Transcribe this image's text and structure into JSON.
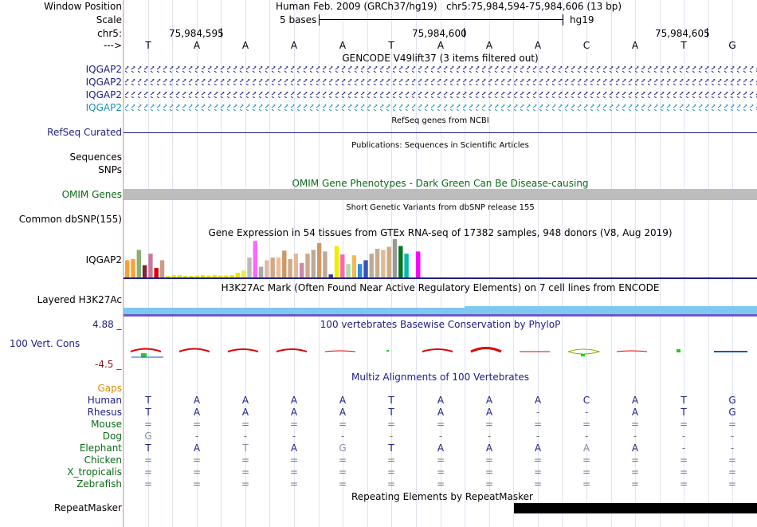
{
  "header": {
    "window_position_label": "Window Position",
    "scale_label": "Scale",
    "chrom_label": "chr5:",
    "strand_label": "--->",
    "title": "Human Feb. 2009 (GRCh37/hg19)   chr5:75,984,594-75,984,606 (13 bp)",
    "scale_text": "5 bases",
    "assembly": "hg19",
    "ticks": [
      "75,984,595",
      "75,984,600",
      "75,984,605"
    ]
  },
  "sequence": [
    "T",
    "A",
    "A",
    "A",
    "A",
    "T",
    "A",
    "A",
    "A",
    "C",
    "A",
    "T",
    "G"
  ],
  "tracks": {
    "gencode": {
      "title": "GENCODE V49lift37 (3 items filtered out)",
      "rows": [
        "IQGAP2",
        "IQGAP2",
        "IQGAP2",
        "IQGAP2"
      ]
    },
    "refseq": {
      "label": "RefSeq Curated",
      "title": "RefSeq genes from NCBI"
    },
    "publications": {
      "title": "Publications: Sequences in Scientific Articles",
      "label1": "Sequences",
      "label2": "SNPs"
    },
    "omim": {
      "label": "OMIM Genes",
      "title": "OMIM Gene Phenotypes - Dark Green Can Be Disease-causing"
    },
    "dbsnp": {
      "label": "Common dbSNP(155)",
      "title": "Short Genetic Variants from dbSNP release 155"
    },
    "gtex": {
      "label": "IQGAP2",
      "title": "Gene Expression in 54 tissues from GTEx RNA-seq of 17382 samples, 948 donors (V8, Aug 2019)"
    },
    "h3k27ac": {
      "label": "Layered H3K27Ac",
      "title": "H3K27Ac Mark (Often Found Near Active Regulatory Elements) on 7 cell lines from ENCODE"
    },
    "phylop": {
      "label": "100 Vert. Cons",
      "max": "4.88 _",
      "min": "-4.5 _",
      "title": "100 vertebrates Basewise Conservation by PhyloP"
    },
    "multiz": {
      "title": "Multiz Alignments of 100 Vertebrates",
      "gaps_label": "Gaps"
    },
    "repeatmasker": {
      "label": "RepeatMasker",
      "title": "Repeating Elements by RepeatMasker"
    }
  },
  "alignment": [
    {
      "species": "Human",
      "bases": [
        "T",
        "A",
        "A",
        "A",
        "A",
        "T",
        "A",
        "A",
        "A",
        "C",
        "A",
        "T",
        "G"
      ]
    },
    {
      "species": "Rhesus",
      "bases": [
        "T",
        "A",
        "A",
        "A",
        "A",
        "T",
        "A",
        "A",
        "-",
        "-",
        "A",
        "T",
        "G"
      ]
    },
    {
      "species": "Mouse",
      "bases": [
        "=",
        "=",
        "=",
        "=",
        "=",
        "=",
        "=",
        "=",
        "=",
        "=",
        "=",
        "=",
        "="
      ]
    },
    {
      "species": "Dog",
      "bases": [
        "G",
        "-",
        "-",
        "-",
        "-",
        "-",
        "-",
        "-",
        "-",
        "-",
        "-",
        "-",
        "-"
      ]
    },
    {
      "species": "Elephant",
      "bases": [
        "T",
        "A",
        "T",
        "A",
        "G",
        "T",
        "A",
        "A",
        "A",
        "A",
        "A",
        "-",
        "-"
      ]
    },
    {
      "species": "Chicken",
      "bases": [
        "=",
        "=",
        "=",
        "=",
        "=",
        "=",
        "=",
        "=",
        "=",
        "=",
        "=",
        "=",
        "="
      ]
    },
    {
      "species": "X_tropicalis",
      "bases": [
        "=",
        "=",
        "=",
        "=",
        "=",
        "=",
        "=",
        "=",
        "=",
        "=",
        "=",
        "=",
        "="
      ]
    },
    {
      "species": "Zebrafish",
      "bases": [
        "=",
        "=",
        "=",
        "=",
        "=",
        "=",
        "=",
        "=",
        "=",
        "=",
        "=",
        "=",
        "="
      ]
    }
  ],
  "gtex_bars": [
    {
      "value": 0.45,
      "color": "#ff9f33"
    },
    {
      "value": 0.48,
      "color": "#ff9f33"
    },
    {
      "value": 0.72,
      "color": "#88b073"
    },
    {
      "value": 0.32,
      "color": "#8a1f38"
    },
    {
      "value": 0.62,
      "color": "#cc7799"
    },
    {
      "value": 0.25,
      "color": "#dd0000"
    },
    {
      "value": 0.45,
      "color": "#cc9988"
    },
    {
      "value": 0.04,
      "color": "#e6e600"
    },
    {
      "value": 0.06,
      "color": "#e6e600"
    },
    {
      "value": 0.06,
      "color": "#e6e600"
    },
    {
      "value": 0.04,
      "color": "#e6e600"
    },
    {
      "value": 0.04,
      "color": "#e6e600"
    },
    {
      "value": 0.05,
      "color": "#e6e600"
    },
    {
      "value": 0.06,
      "color": "#e6e600"
    },
    {
      "value": 0.05,
      "color": "#e6e600"
    },
    {
      "value": 0.06,
      "color": "#e6e600"
    },
    {
      "value": 0.05,
      "color": "#e6e600"
    },
    {
      "value": 0.05,
      "color": "#e6e600"
    },
    {
      "value": 0.06,
      "color": "#e6e600"
    },
    {
      "value": 0.12,
      "color": "#e6e600"
    },
    {
      "value": 0.18,
      "color": "#eeee44"
    },
    {
      "value": 0.52,
      "color": "#bbbbbb"
    },
    {
      "value": 0.95,
      "color": "#ff66ff"
    },
    {
      "value": 0.28,
      "color": "#aaaaaa"
    },
    {
      "value": 0.45,
      "color": "#ddbbaa"
    },
    {
      "value": 0.52,
      "color": "#ccaa88"
    },
    {
      "value": 0.52,
      "color": "#eebb99"
    },
    {
      "value": 0.7,
      "color": "#cc9966"
    },
    {
      "value": 0.48,
      "color": "#ccaa88"
    },
    {
      "value": 0.62,
      "color": "#ddbb99"
    },
    {
      "value": 0.38,
      "color": "#cc88aa"
    },
    {
      "value": 0.62,
      "color": "#ccaa88"
    },
    {
      "value": 0.72,
      "color": "#bbaa99"
    },
    {
      "value": 0.9,
      "color": "#cc9966"
    },
    {
      "value": 0.68,
      "color": "#bbaa99"
    },
    {
      "value": 0.08,
      "color": "#333399"
    },
    {
      "value": 0.82,
      "color": "#eeee00"
    },
    {
      "value": 0.6,
      "color": "#ff66aa"
    },
    {
      "value": 0.35,
      "color": "#aaddaa"
    },
    {
      "value": 0.58,
      "color": "#eebb55"
    },
    {
      "value": 0.35,
      "color": "#3388dd"
    },
    {
      "value": 0.45,
      "color": "#3355bb"
    },
    {
      "value": 0.62,
      "color": "#bbaa99"
    },
    {
      "value": 0.75,
      "color": "#ccaa88"
    },
    {
      "value": 0.72,
      "color": "#ddbb99"
    },
    {
      "value": 0.8,
      "color": "#ccaa88"
    },
    {
      "value": 1.0,
      "color": "#999999"
    },
    {
      "value": 0.82,
      "color": "#007722"
    },
    {
      "value": 0.62,
      "color": "#00bbaa"
    },
    {
      "value": 0.58,
      "color": "#ffffff"
    },
    {
      "value": 0.68,
      "color": "#ff00ff"
    }
  ],
  "colors": {
    "navy": "#1d2087",
    "green": "#0b6b16",
    "orange": "#e38a00",
    "omim_bar": "#bdbdbd",
    "h3k27ac": "#7ec8f0",
    "repeat": "#000000",
    "phylop_pos": "#e00000",
    "phylop_neg": "#1050d0"
  }
}
